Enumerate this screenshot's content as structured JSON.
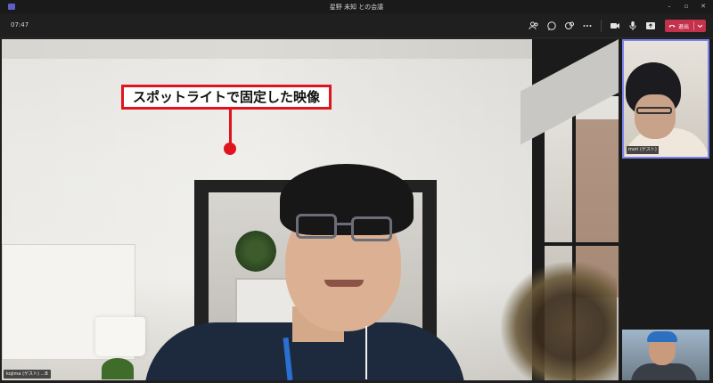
{
  "window": {
    "title": "星野 未知 との会議",
    "controls": {
      "minimize": "–",
      "restore": "▫",
      "close": "✕"
    }
  },
  "toolbar": {
    "elapsed_time": "07:47",
    "buttons": [
      {
        "name": "participants-icon"
      },
      {
        "name": "chat-icon"
      },
      {
        "name": "reactions-icon"
      },
      {
        "name": "more-actions-icon"
      },
      {
        "name": "camera-icon"
      },
      {
        "name": "microphone-icon"
      },
      {
        "name": "share-screen-icon"
      }
    ],
    "leave_label": "退出",
    "colors": {
      "leave": "#c4314b",
      "accent": "#7b83eb"
    }
  },
  "stage": {
    "annotation": "スポットライトで固定した映像",
    "participant_label": "kojima (ゲスト) ...B"
  },
  "gallery": {
    "tiles": [
      {
        "label": "mori (ゲスト)"
      },
      {
        "label": ""
      }
    ]
  }
}
